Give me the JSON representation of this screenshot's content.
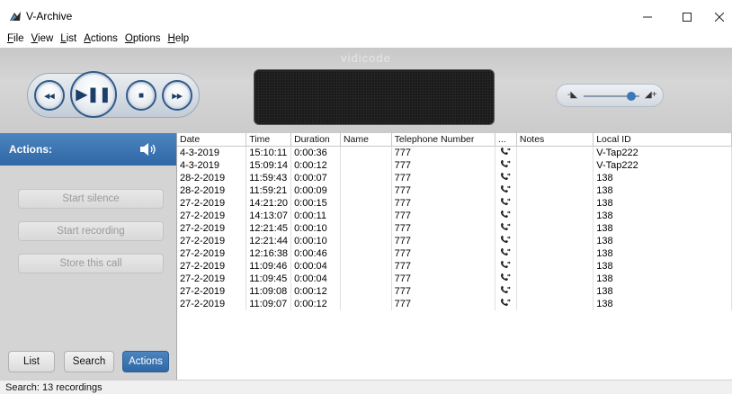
{
  "window": {
    "title": "V-Archive"
  },
  "menu": [
    {
      "mnemonic": "F",
      "rest": "ile"
    },
    {
      "mnemonic": "V",
      "rest": "iew"
    },
    {
      "mnemonic": "L",
      "rest": "ist"
    },
    {
      "mnemonic": "A",
      "rest": "ctions"
    },
    {
      "mnemonic": "O",
      "rest": "ptions"
    },
    {
      "mnemonic": "H",
      "rest": "elp"
    }
  ],
  "player": {
    "brand": "vidicode",
    "volume_level": 0.85
  },
  "actions_panel": {
    "title": "Actions:",
    "buttons": [
      "Start silence",
      "Start recording",
      "Store this call"
    ]
  },
  "bottom_tabs": {
    "list": "List",
    "search": "Search",
    "actions": "Actions",
    "active": "Actions"
  },
  "table": {
    "columns": [
      "Date",
      "Time",
      "Duration",
      "Name",
      "Telephone Number",
      "...",
      "Notes",
      "Local ID"
    ],
    "rows": [
      {
        "date": "4-3-2019",
        "time": "15:10:11",
        "duration": "0:00:36",
        "name": "",
        "tel": "777",
        "notes": "",
        "local_id": "V-Tap222"
      },
      {
        "date": "4-3-2019",
        "time": "15:09:14",
        "duration": "0:00:12",
        "name": "",
        "tel": "777",
        "notes": "",
        "local_id": "V-Tap222"
      },
      {
        "date": "28-2-2019",
        "time": "11:59:43",
        "duration": "0:00:07",
        "name": "",
        "tel": "777",
        "notes": "",
        "local_id": "138"
      },
      {
        "date": "28-2-2019",
        "time": "11:59:21",
        "duration": "0:00:09",
        "name": "",
        "tel": "777",
        "notes": "",
        "local_id": "138"
      },
      {
        "date": "27-2-2019",
        "time": "14:21:20",
        "duration": "0:00:15",
        "name": "",
        "tel": "777",
        "notes": "",
        "local_id": "138"
      },
      {
        "date": "27-2-2019",
        "time": "14:13:07",
        "duration": "0:00:11",
        "name": "",
        "tel": "777",
        "notes": "",
        "local_id": "138"
      },
      {
        "date": "27-2-2019",
        "time": "12:21:45",
        "duration": "0:00:10",
        "name": "",
        "tel": "777",
        "notes": "",
        "local_id": "138"
      },
      {
        "date": "27-2-2019",
        "time": "12:21:44",
        "duration": "0:00:10",
        "name": "",
        "tel": "777",
        "notes": "",
        "local_id": "138"
      },
      {
        "date": "27-2-2019",
        "time": "12:16:38",
        "duration": "0:00:46",
        "name": "",
        "tel": "777",
        "notes": "",
        "local_id": "138"
      },
      {
        "date": "27-2-2019",
        "time": "11:09:46",
        "duration": "0:00:04",
        "name": "",
        "tel": "777",
        "notes": "",
        "local_id": "138"
      },
      {
        "date": "27-2-2019",
        "time": "11:09:45",
        "duration": "0:00:04",
        "name": "",
        "tel": "777",
        "notes": "",
        "local_id": "138"
      },
      {
        "date": "27-2-2019",
        "time": "11:09:08",
        "duration": "0:00:12",
        "name": "",
        "tel": "777",
        "notes": "",
        "local_id": "138"
      },
      {
        "date": "27-2-2019",
        "time": "11:09:07",
        "duration": "0:00:12",
        "name": "",
        "tel": "777",
        "notes": "",
        "local_id": "138"
      }
    ]
  },
  "status": {
    "text": "Search: 13 recordings"
  },
  "colors": {
    "accent": "#2f68a5",
    "player_bg": "#cbcbcb",
    "display_bg": "#1a1a1a"
  }
}
